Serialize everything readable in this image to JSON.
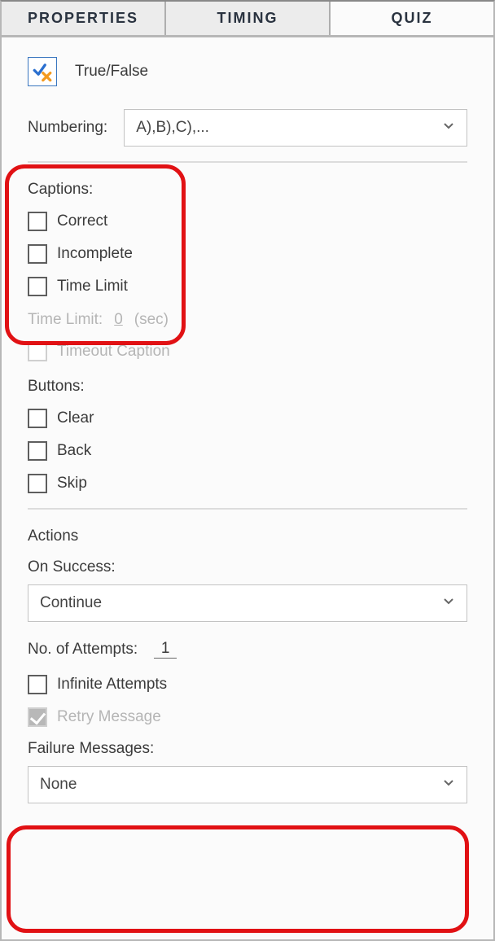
{
  "tabs": {
    "properties": "PROPERTIES",
    "timing": "TIMING",
    "quiz": "QUIZ"
  },
  "questionType": "True/False",
  "numbering": {
    "label": "Numbering:",
    "value": "A),B),C),..."
  },
  "captions": {
    "title": "Captions:",
    "correct": "Correct",
    "incomplete": "Incomplete",
    "timeLimit": "Time Limit"
  },
  "timeLimit": {
    "label": "Time Limit:",
    "value": "0",
    "unit": "(sec)",
    "timeoutCaption": "Timeout Caption"
  },
  "buttons": {
    "title": "Buttons:",
    "clear": "Clear",
    "back": "Back",
    "skip": "Skip"
  },
  "actions": {
    "title": "Actions",
    "onSuccessLabel": "On Success:",
    "onSuccessValue": "Continue",
    "attemptsLabel": "No. of Attempts:",
    "attemptsValue": "1",
    "infiniteAttempts": "Infinite Attempts",
    "retryMessage": "Retry Message",
    "failureMessagesLabel": "Failure Messages:",
    "failureMessagesValue": "None"
  }
}
